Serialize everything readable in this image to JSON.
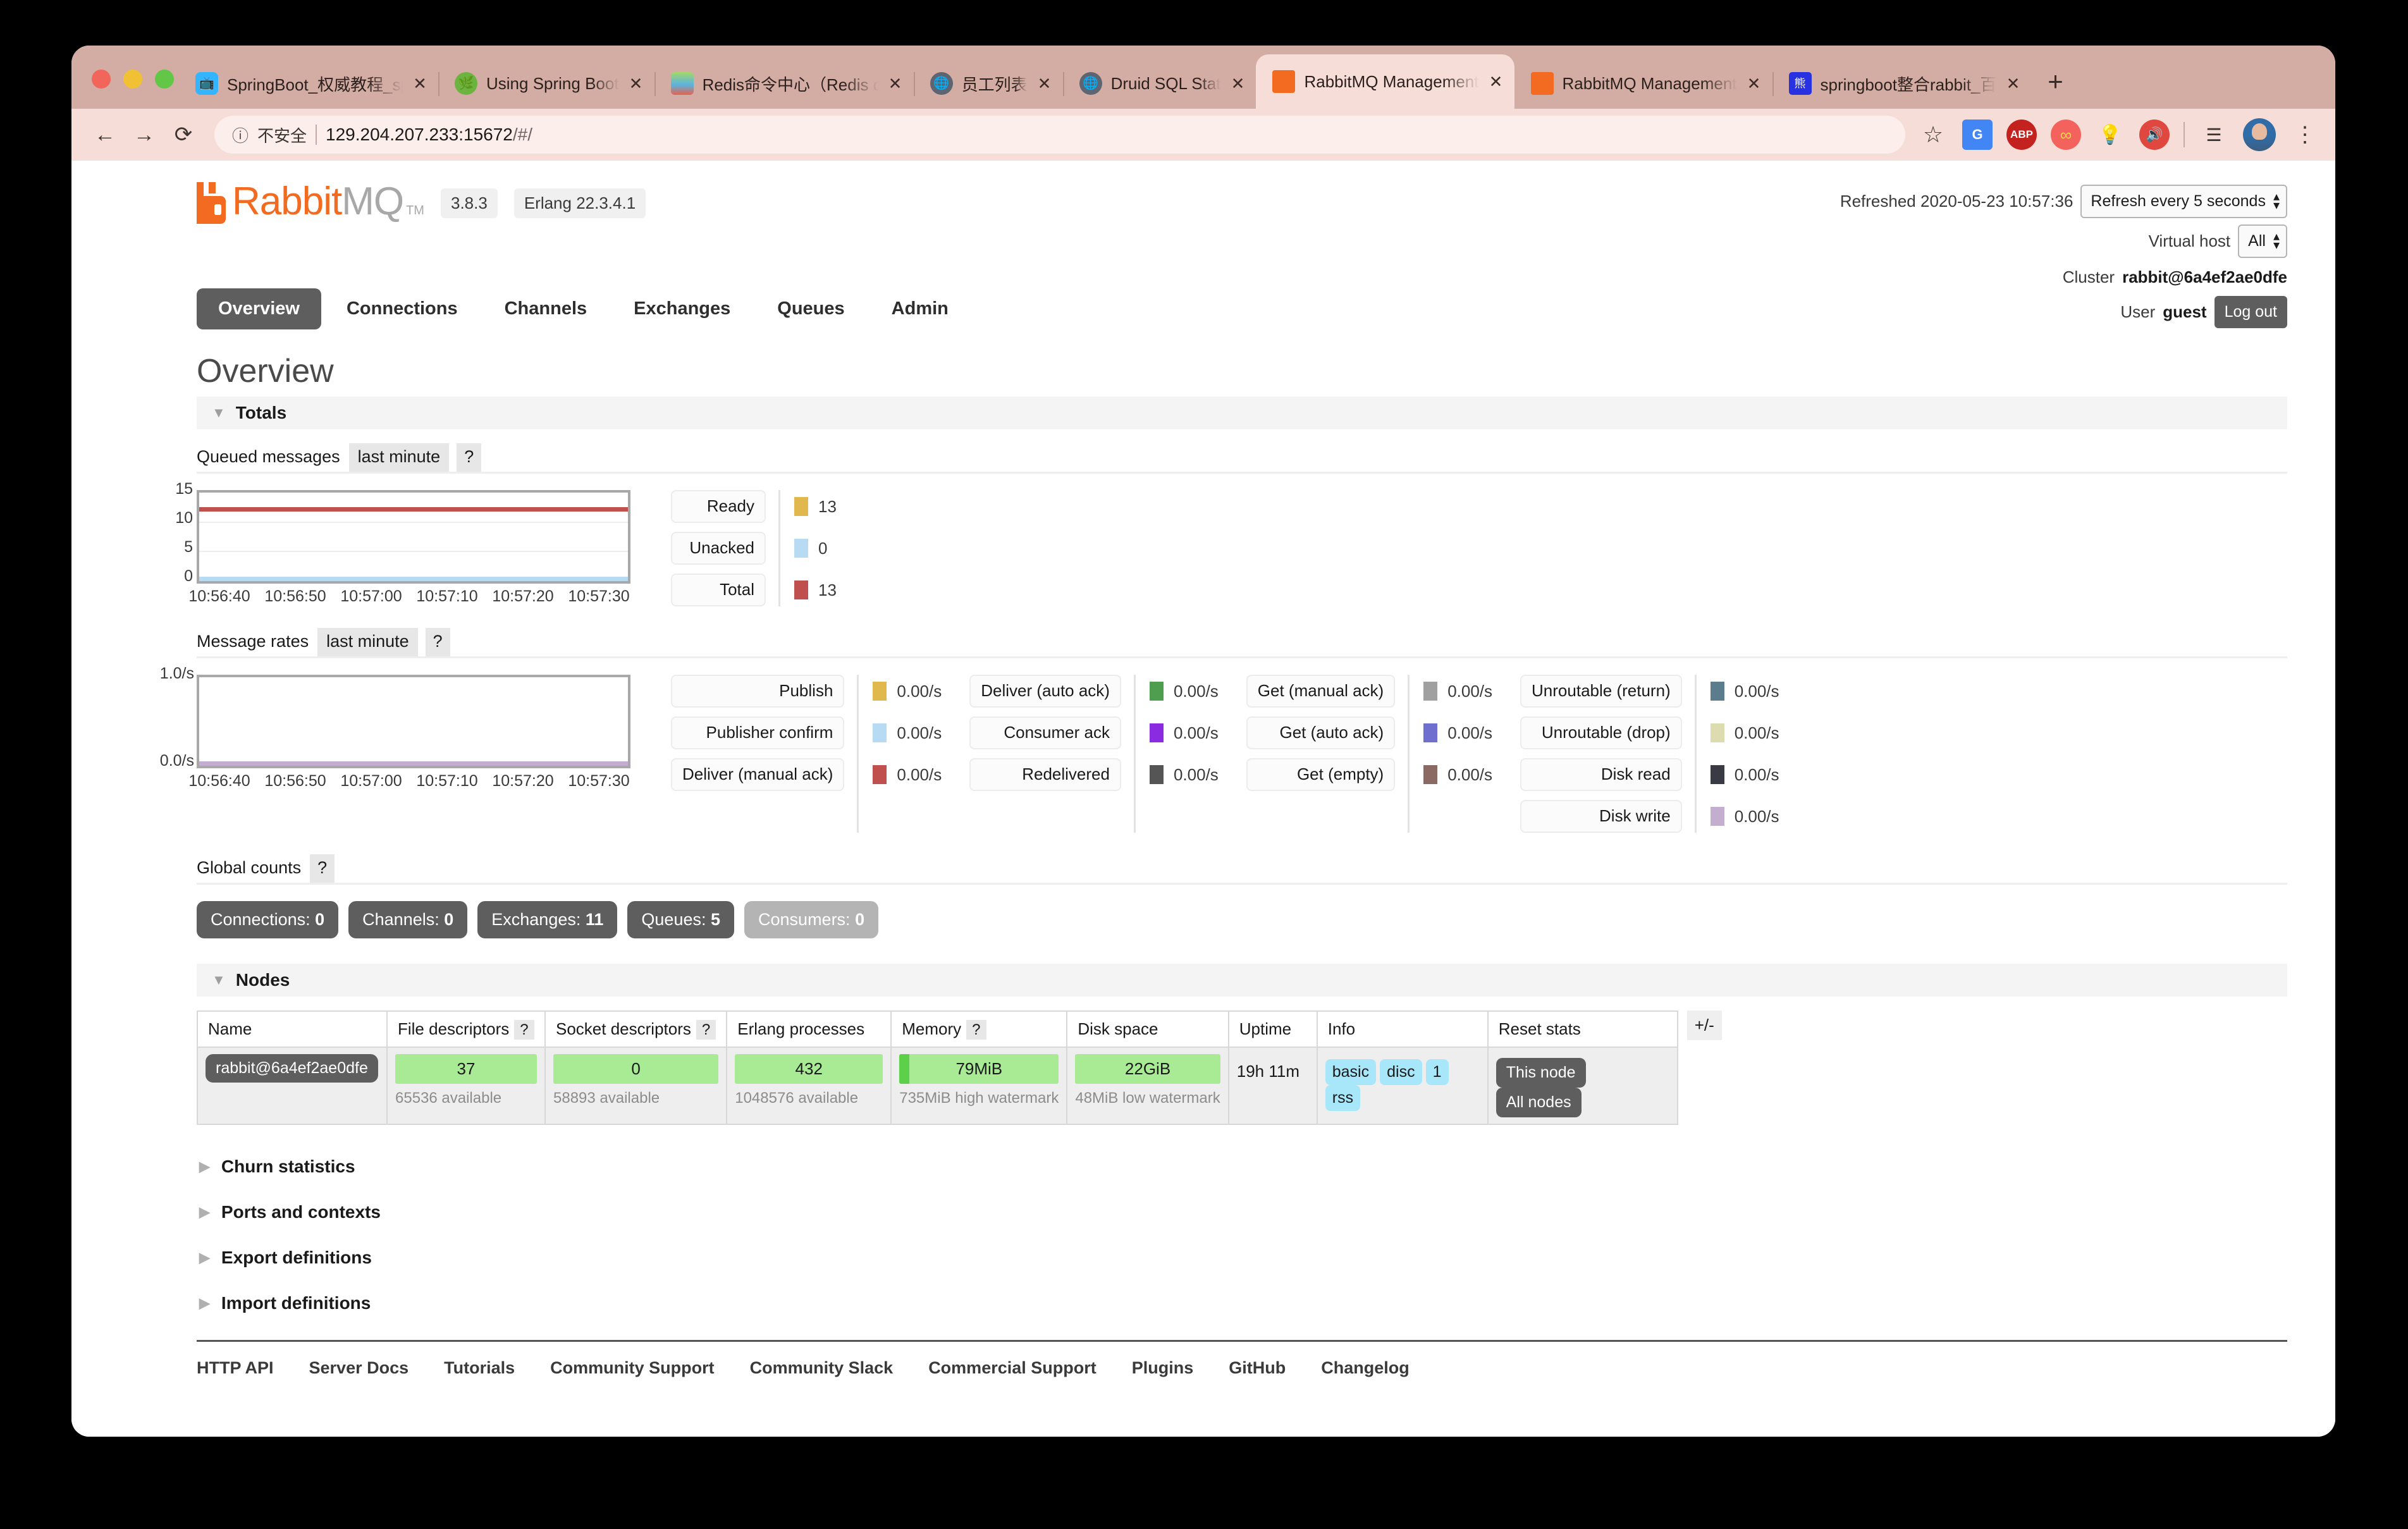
{
  "browser": {
    "tabs": [
      {
        "title": "SpringBoot_权威教程_spr",
        "favicon": "bilibili-icon",
        "active": false
      },
      {
        "title": "Using Spring Boot",
        "favicon": "spring-icon",
        "active": false
      },
      {
        "title": "Redis命令中心（Redis co",
        "favicon": "redis-icon",
        "active": false
      },
      {
        "title": "员工列表",
        "favicon": "globe-icon",
        "active": false
      },
      {
        "title": "Druid SQL Stat",
        "favicon": "globe-icon",
        "active": false
      },
      {
        "title": "RabbitMQ Management",
        "favicon": "rabbitmq-icon",
        "active": true
      },
      {
        "title": "RabbitMQ Management",
        "favicon": "rabbitmq-icon",
        "active": false
      },
      {
        "title": "springboot整合rabbit_百度",
        "favicon": "baidu-icon",
        "active": false
      }
    ],
    "new_tab_label": "+",
    "close_label": "✕",
    "nav": {
      "back": "←",
      "forward": "→",
      "reload": "⟳"
    },
    "omnibox": {
      "info_icon": "ⓘ",
      "security_label": "不安全",
      "url_host": "129.204.207.233:15672",
      "url_path": "/#/"
    },
    "toolbar_icons": [
      {
        "name": "bookmark-star-icon",
        "glyph": "☆"
      },
      {
        "name": "google-translate-icon",
        "glyph": "G"
      },
      {
        "name": "adblock-plus-icon",
        "glyph": "ABP"
      },
      {
        "name": "infinity-extension-icon",
        "glyph": "∞"
      },
      {
        "name": "lightbulb-extension-icon",
        "glyph": "💡"
      },
      {
        "name": "mute-tab-icon",
        "glyph": "🔊"
      },
      {
        "name": "media-list-icon",
        "glyph": "☰♪"
      },
      {
        "name": "profile-avatar",
        "glyph": ""
      },
      {
        "name": "chrome-menu-icon",
        "glyph": "⋮"
      }
    ]
  },
  "app": {
    "logo": {
      "rabbit": "Rabbit",
      "mq": "MQ",
      "tm": "TM"
    },
    "version": "3.8.3",
    "erlang": "Erlang 22.3.4.1",
    "refreshed_label": "Refreshed 2020-05-23 10:57:36",
    "refresh_select": "Refresh every 5 seconds",
    "vhost_label": "Virtual host",
    "vhost_value": "All",
    "cluster_label": "Cluster",
    "cluster_value": "rabbit@6a4ef2ae0dfe",
    "user_label": "User",
    "user_value": "guest",
    "logout_label": "Log out",
    "nav_tabs": [
      {
        "label": "Overview",
        "active": true
      },
      {
        "label": "Connections",
        "active": false
      },
      {
        "label": "Channels",
        "active": false
      },
      {
        "label": "Exchanges",
        "active": false
      },
      {
        "label": "Queues",
        "active": false
      },
      {
        "label": "Admin",
        "active": false
      }
    ],
    "page_title": "Overview"
  },
  "totals": {
    "section_label": "Totals",
    "queued": {
      "title": "Queued messages",
      "period": "last minute",
      "help": "?"
    },
    "rates": {
      "title": "Message rates",
      "period": "last minute",
      "help": "?"
    },
    "global_counts": {
      "title": "Global counts",
      "help": "?",
      "badges": [
        {
          "label": "Connections:",
          "value": "0",
          "dim": false
        },
        {
          "label": "Channels:",
          "value": "0",
          "dim": false
        },
        {
          "label": "Exchanges:",
          "value": "11",
          "dim": false
        },
        {
          "label": "Queues:",
          "value": "5",
          "dim": false
        },
        {
          "label": "Consumers:",
          "value": "0",
          "dim": true
        }
      ]
    }
  },
  "chart_data": [
    {
      "type": "line",
      "title": "Queued messages",
      "subtitle": "last minute",
      "x": [
        "10:56:40",
        "10:56:50",
        "10:57:00",
        "10:57:10",
        "10:57:20",
        "10:57:30"
      ],
      "xlabel": "",
      "ylabel": "",
      "ylim": [
        0,
        15
      ],
      "yticks": [
        0,
        5,
        10,
        15
      ],
      "grid": true,
      "legend_position": "right",
      "series": [
        {
          "name": "Ready",
          "color": "#e0b84e",
          "value": 13,
          "values": [
            13,
            13,
            13,
            13,
            13,
            13
          ]
        },
        {
          "name": "Unacked",
          "color": "#b6dbf2",
          "value": 0,
          "values": [
            0,
            0,
            0,
            0,
            0,
            0
          ]
        },
        {
          "name": "Total",
          "color": "#c0504d",
          "value": 13,
          "values": [
            13,
            13,
            13,
            13,
            13,
            13
          ]
        }
      ]
    },
    {
      "type": "line",
      "title": "Message rates",
      "subtitle": "last minute",
      "x": [
        "10:56:40",
        "10:56:50",
        "10:57:00",
        "10:57:10",
        "10:57:20",
        "10:57:30"
      ],
      "xlabel": "",
      "ylabel": "",
      "ylim": [
        0,
        1.0
      ],
      "yticks": [
        "0.0/s",
        "1.0/s"
      ],
      "grid": false,
      "legend_position": "right",
      "series": [
        {
          "name": "Publish",
          "color": "#e0b84e",
          "value": "0.00/s",
          "values": [
            0,
            0,
            0,
            0,
            0,
            0
          ]
        },
        {
          "name": "Publisher confirm",
          "color": "#b6dbf2",
          "value": "0.00/s",
          "values": [
            0,
            0,
            0,
            0,
            0,
            0
          ]
        },
        {
          "name": "Deliver (manual ack)",
          "color": "#c0504d",
          "value": "0.00/s",
          "values": [
            0,
            0,
            0,
            0,
            0,
            0
          ]
        },
        {
          "name": "Deliver (auto ack)",
          "color": "#4f9e4f",
          "value": "0.00/s",
          "values": [
            0,
            0,
            0,
            0,
            0,
            0
          ]
        },
        {
          "name": "Consumer ack",
          "color": "#8a2be2",
          "value": "0.00/s",
          "values": [
            0,
            0,
            0,
            0,
            0,
            0
          ]
        },
        {
          "name": "Redelivered",
          "color": "#555555",
          "value": "0.00/s",
          "values": [
            0,
            0,
            0,
            0,
            0,
            0
          ]
        },
        {
          "name": "Get (manual ack)",
          "color": "#a0a0a0",
          "value": "0.00/s",
          "values": [
            0,
            0,
            0,
            0,
            0,
            0
          ]
        },
        {
          "name": "Get (auto ack)",
          "color": "#6f6fd0",
          "value": "0.00/s",
          "values": [
            0,
            0,
            0,
            0,
            0,
            0
          ]
        },
        {
          "name": "Get (empty)",
          "color": "#8a6a62",
          "value": "0.00/s",
          "values": [
            0,
            0,
            0,
            0,
            0,
            0
          ]
        },
        {
          "name": "Unroutable (return)",
          "color": "#5b7c8d",
          "value": "0.00/s",
          "values": [
            0,
            0,
            0,
            0,
            0,
            0
          ]
        },
        {
          "name": "Unroutable (drop)",
          "color": "#dcdcb0",
          "value": "0.00/s",
          "values": [
            0,
            0,
            0,
            0,
            0,
            0
          ]
        },
        {
          "name": "Disk read",
          "color": "#3a3a45",
          "value": "0.00/s",
          "values": [
            0,
            0,
            0,
            0,
            0,
            0
          ]
        },
        {
          "name": "Disk write",
          "color": "#c3aed0",
          "value": "0.00/s",
          "values": [
            0,
            0,
            0,
            0,
            0,
            0
          ]
        }
      ]
    }
  ],
  "nodes": {
    "section_label": "Nodes",
    "plus_minus": "+/-",
    "columns": [
      {
        "label": "Name",
        "help": ""
      },
      {
        "label": "File descriptors",
        "help": "?"
      },
      {
        "label": "Socket descriptors",
        "help": "?"
      },
      {
        "label": "Erlang processes",
        "help": ""
      },
      {
        "label": "Memory",
        "help": "?"
      },
      {
        "label": "Disk space",
        "help": ""
      },
      {
        "label": "Uptime",
        "help": ""
      },
      {
        "label": "Info",
        "help": ""
      },
      {
        "label": "Reset stats",
        "help": ""
      }
    ],
    "row": {
      "name": "rabbit@6a4ef2ae0dfe",
      "file_descriptors": "37",
      "file_descriptors_note": "65536 available",
      "socket_descriptors": "0",
      "socket_descriptors_note": "58893 available",
      "erlang_processes": "432",
      "erlang_processes_note": "1048576 available",
      "memory": "79MiB",
      "memory_note": "735MiB high watermark",
      "disk_space": "22GiB",
      "disk_space_note": "48MiB low watermark",
      "uptime": "19h 11m",
      "info_tags": [
        "basic",
        "disc",
        "1",
        "rss"
      ],
      "reset_buttons": [
        "This node",
        "All nodes"
      ]
    }
  },
  "collapsed_sections": [
    {
      "label": "Churn statistics"
    },
    {
      "label": "Ports and contexts"
    },
    {
      "label": "Export definitions"
    },
    {
      "label": "Import definitions"
    }
  ],
  "footer_links": [
    "HTTP API",
    "Server Docs",
    "Tutorials",
    "Community Support",
    "Community Slack",
    "Commercial Support",
    "Plugins",
    "GitHub",
    "Changelog"
  ]
}
